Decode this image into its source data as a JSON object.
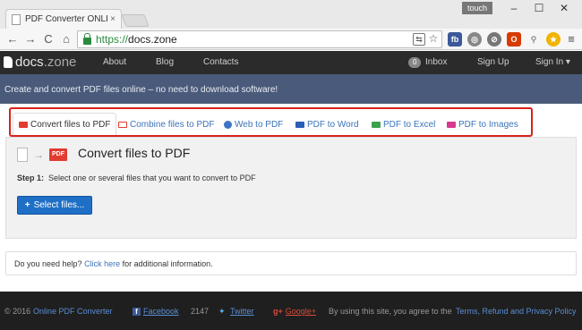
{
  "browser": {
    "tab_title": "PDF Converter ONLINE",
    "tab_close": "×",
    "user_badge": "touch",
    "window_controls": {
      "minimize": "–",
      "maximize": "☐",
      "close": "✕"
    },
    "nav": {
      "back": "←",
      "forward": "→",
      "reload": "C",
      "home": "⌂"
    },
    "url_scheme": "https://",
    "url_host": "docs.zone"
  },
  "site": {
    "logo_main": "docs",
    "logo_tld": ".zone",
    "nav_links": [
      "About",
      "Blog",
      "Contacts"
    ],
    "inbox_count": "0",
    "inbox_label": "Inbox",
    "signup": "Sign Up",
    "signin": "Sign In ▾",
    "banner": "Create and convert PDF files online – no need to download software!"
  },
  "tools": {
    "tabs": [
      {
        "label": "Convert files to PDF",
        "icon": "pdf-icon"
      },
      {
        "label": "Combine files to PDF",
        "icon": "combine-icon"
      },
      {
        "label": "Web to PDF",
        "icon": "globe-icon"
      },
      {
        "label": "PDF to Word",
        "icon": "word-icon"
      },
      {
        "label": "PDF to Excel",
        "icon": "excel-icon"
      },
      {
        "label": "PDF to Images",
        "icon": "images-icon"
      }
    ]
  },
  "converter": {
    "title": "Convert files to PDF",
    "pdf_badge": "PDF",
    "step_label": "Step 1:",
    "step_text": "Select one or several files that you want to convert to PDF",
    "select_button": "Select files...",
    "select_plus": "+"
  },
  "help": {
    "prefix": "Do you need help?",
    "link": "Click here",
    "suffix": "for additional information."
  },
  "footer": {
    "copyright": "© 2016",
    "brand_link": "Online PDF Converter",
    "facebook": "Facebook",
    "facebook_count": "2147",
    "twitter": "Twitter",
    "googleplus": "Google+",
    "terms_prefix": "By using this site, you agree to the",
    "terms_link": "Terms, Refund and Privacy Policy"
  },
  "colors": {
    "accent_blue": "#1f6fc6",
    "highlight_red": "#d9221b",
    "nav_dark": "#2b2b2b",
    "banner": "#4a5a7a"
  }
}
